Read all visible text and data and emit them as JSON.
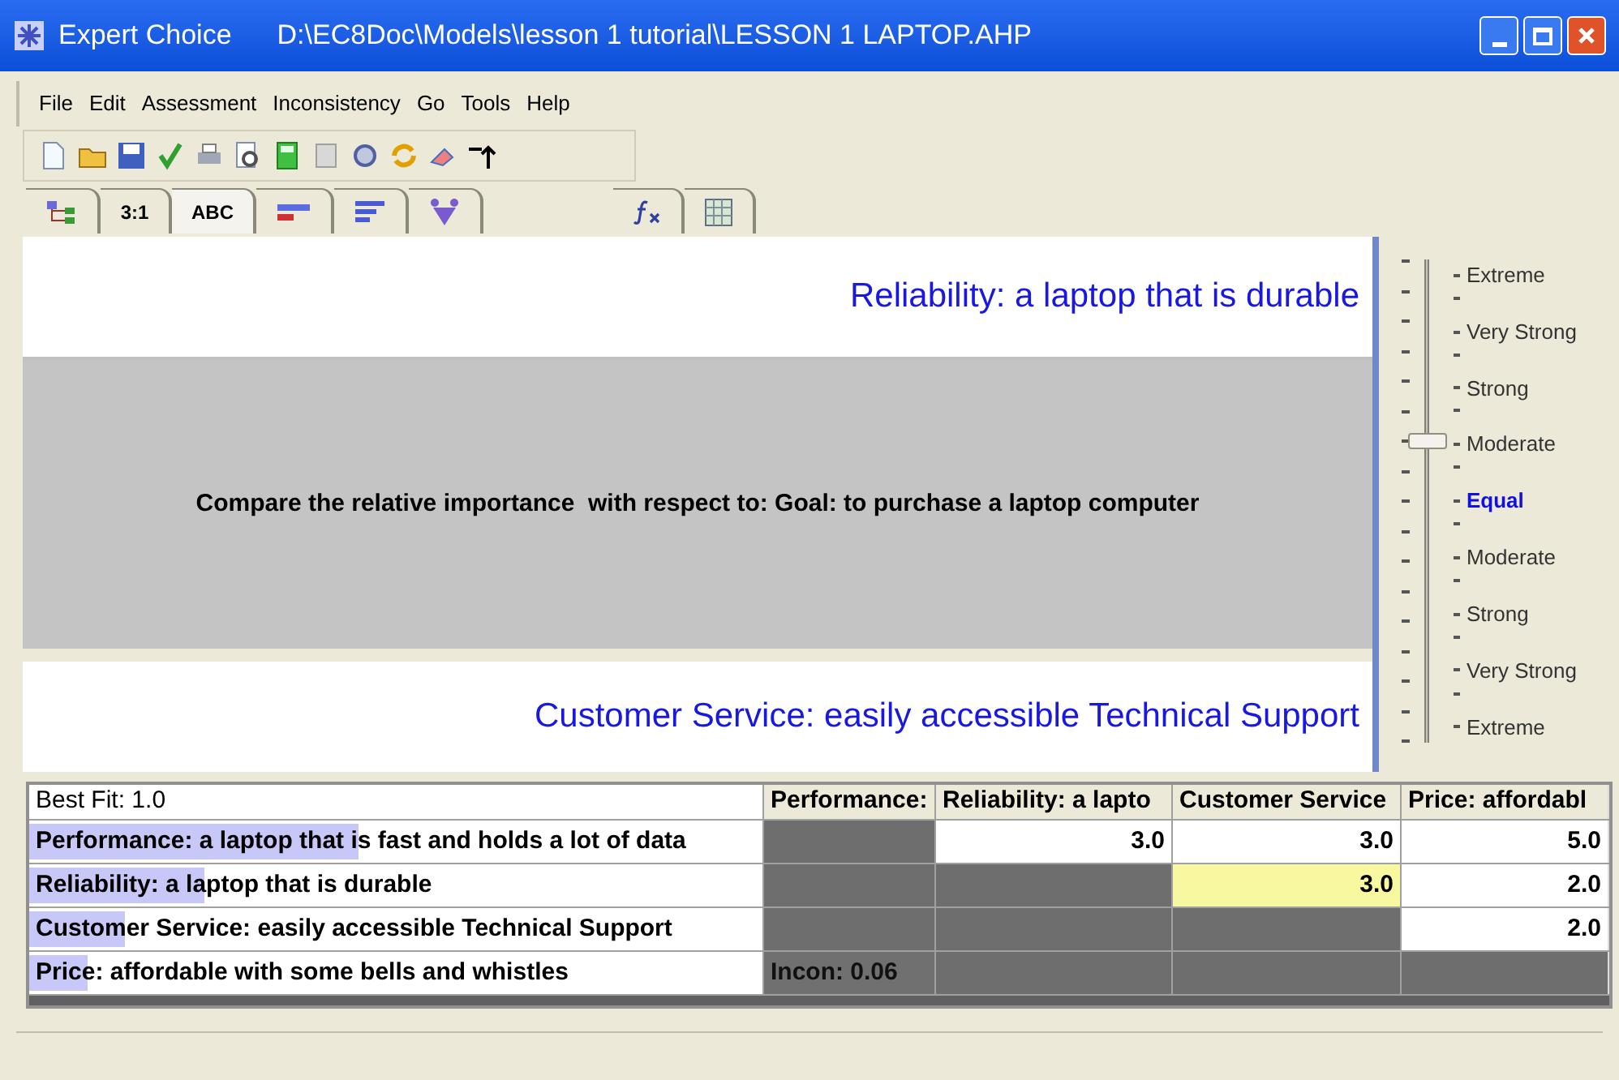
{
  "window": {
    "title": "Expert Choice",
    "path": "D:\\EC8Doc\\Models\\lesson 1 tutorial\\LESSON 1 LAPTOP.AHP"
  },
  "menu": [
    "File",
    "Edit",
    "Assessment",
    "Inconsistency",
    "Go",
    "Tools",
    "Help"
  ],
  "tabs": [
    {
      "kind": "icon",
      "selected": false
    },
    {
      "kind": "text",
      "label": "3:1",
      "selected": false
    },
    {
      "kind": "text",
      "label": "ABC",
      "selected": true
    },
    {
      "kind": "icon",
      "selected": false
    },
    {
      "kind": "icon",
      "selected": false
    },
    {
      "kind": "icon",
      "selected": false
    },
    {
      "kind": "icon",
      "selected": false
    },
    {
      "kind": "icon",
      "selected": false
    }
  ],
  "comparison": {
    "top_element": "Reliability: a laptop that is durable",
    "question": "Compare the relative importance  with respect to: Goal: to purchase a laptop computer",
    "bottom_element": "Customer Service:  easily accessible Technical Support"
  },
  "scale": {
    "level": 0.625,
    "labels": [
      {
        "text": "Extreme",
        "kind": "intensity"
      },
      {
        "text": "Very Strong",
        "kind": "intensity"
      },
      {
        "text": "Strong",
        "kind": "intensity"
      },
      {
        "text": "Moderate",
        "kind": "intensity"
      },
      {
        "text": "Equal",
        "kind": "neutral"
      },
      {
        "text": "Moderate",
        "kind": "intensity"
      },
      {
        "text": "Strong",
        "kind": "intensity"
      },
      {
        "text": "Very Strong",
        "kind": "intensity"
      },
      {
        "text": "Extreme",
        "kind": "intensity"
      }
    ]
  },
  "matrix": {
    "corner": "Best Fit: 1.0",
    "columns": [
      "Performance:",
      "Reliability: a lapto",
      "Customer Service",
      "Price:  affordabl"
    ],
    "rows": [
      {
        "label": "Performance: a laptop that is fast and holds a lot of data",
        "level": 0.45,
        "cells": [
          {
            "kind": "blank",
            "selected": false
          },
          {
            "kind": "value",
            "text": "3.0",
            "selected": false
          },
          {
            "kind": "value",
            "text": "3.0",
            "selected": false
          },
          {
            "kind": "value",
            "text": "5.0",
            "selected": false
          }
        ]
      },
      {
        "label": "Reliability: a laptop that is durable",
        "level": 0.24,
        "cells": [
          {
            "kind": "blank",
            "selected": false
          },
          {
            "kind": "blank",
            "selected": false
          },
          {
            "kind": "value",
            "text": "3.0",
            "selected": true
          },
          {
            "kind": "value",
            "text": "2.0",
            "selected": false
          }
        ]
      },
      {
        "label": "Customer Service:  easily accessible Technical Support",
        "level": 0.13,
        "cells": [
          {
            "kind": "blank",
            "selected": false
          },
          {
            "kind": "blank",
            "selected": false
          },
          {
            "kind": "blank",
            "selected": false
          },
          {
            "kind": "value",
            "text": "2.0",
            "selected": false
          }
        ]
      },
      {
        "label": "Price:  affordable with some bells and whistles",
        "level": 0.08,
        "cells": [
          {
            "kind": "info",
            "text": "Incon: 0.06",
            "selected": false
          },
          {
            "kind": "blank",
            "selected": false
          },
          {
            "kind": "blank",
            "selected": false
          },
          {
            "kind": "blank",
            "selected": false
          }
        ]
      }
    ]
  }
}
